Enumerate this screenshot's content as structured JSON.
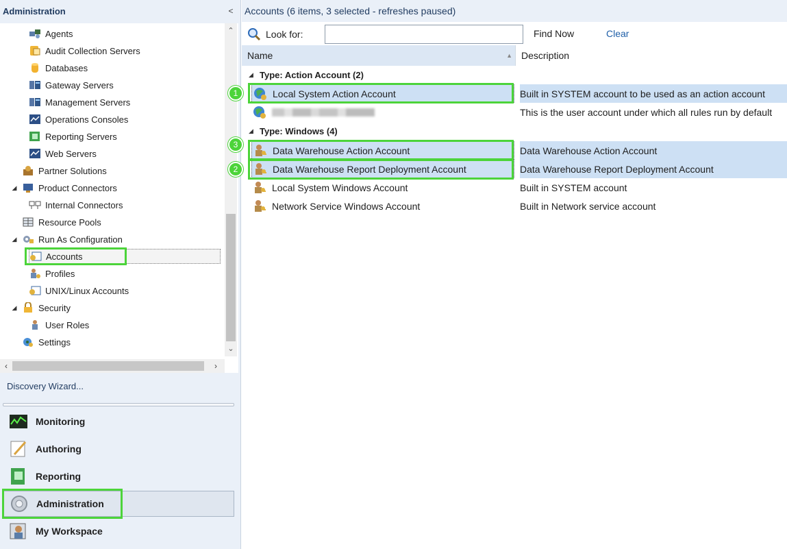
{
  "left_pane": {
    "title": "Administration",
    "collapse_glyph": "<",
    "tree": [
      {
        "label": "Agents",
        "icon": "agents-icon"
      },
      {
        "label": "Audit Collection Servers",
        "icon": "audit-servers-icon"
      },
      {
        "label": "Databases",
        "icon": "database-icon"
      },
      {
        "label": "Gateway Servers",
        "icon": "gateway-servers-icon"
      },
      {
        "label": "Management Servers",
        "icon": "management-servers-icon"
      },
      {
        "label": "Operations Consoles",
        "icon": "operations-consoles-icon"
      },
      {
        "label": "Reporting Servers",
        "icon": "reporting-servers-icon"
      },
      {
        "label": "Web Servers",
        "icon": "web-servers-icon"
      },
      {
        "label": "Partner Solutions",
        "icon": "partner-solutions-icon"
      },
      {
        "label": "Product Connectors",
        "icon": "product-connectors-icon",
        "expanded": true
      },
      {
        "label": "Internal Connectors",
        "icon": "internal-connectors-icon"
      },
      {
        "label": "Resource Pools",
        "icon": "resource-pools-icon"
      },
      {
        "label": "Run As Configuration",
        "icon": "run-as-config-icon",
        "expanded": true
      },
      {
        "label": "Accounts",
        "icon": "accounts-icon",
        "selected": true
      },
      {
        "label": "Profiles",
        "icon": "profiles-icon"
      },
      {
        "label": "UNIX/Linux Accounts",
        "icon": "unix-accounts-icon"
      },
      {
        "label": "Security",
        "icon": "security-lock-icon",
        "expanded": true
      },
      {
        "label": "User Roles",
        "icon": "user-roles-icon"
      },
      {
        "label": "Settings",
        "icon": "settings-icon"
      }
    ],
    "discovery_wizard": "Discovery Wizard...",
    "workspaces": [
      {
        "label": "Monitoring",
        "icon": "monitoring-icon"
      },
      {
        "label": "Authoring",
        "icon": "authoring-icon"
      },
      {
        "label": "Reporting",
        "icon": "reporting-icon"
      },
      {
        "label": "Administration",
        "icon": "administration-icon",
        "selected": true
      },
      {
        "label": "My Workspace",
        "icon": "my-workspace-icon"
      }
    ]
  },
  "right_pane": {
    "title": "Accounts",
    "title_detail": "(6 items, 3 selected - refreshes paused)",
    "search": {
      "label": "Look for:",
      "value": "",
      "find_now": "Find Now",
      "clear": "Clear"
    },
    "columns": {
      "name": "Name",
      "description": "Description"
    },
    "groups": [
      {
        "label": "Type: Action Account (2)",
        "rows": [
          {
            "name": "Local System Action Account",
            "description": "Built in SYSTEM account to be used as an action account",
            "icon": "action-account-globe-icon",
            "selected": true,
            "badge": "1"
          },
          {
            "name": "",
            "description": "This is the user account under which all rules run by default",
            "icon": "action-account-globe-icon",
            "selected": false,
            "redacted": true
          }
        ]
      },
      {
        "label": "Type: Windows (4)",
        "rows": [
          {
            "name": "Data Warehouse Action Account",
            "description": "Data Warehouse Action Account",
            "icon": "windows-account-key-icon",
            "selected": true,
            "badge": "3"
          },
          {
            "name": "Data Warehouse Report Deployment Account",
            "description": "Data Warehouse Report Deployment Account",
            "icon": "windows-account-key-icon",
            "selected": true,
            "badge": "2"
          },
          {
            "name": "Local System Windows Account",
            "description": "Built in SYSTEM account",
            "icon": "windows-account-key-icon",
            "selected": false
          },
          {
            "name": "Network Service Windows Account",
            "description": "Built in Network service account",
            "icon": "windows-account-key-icon",
            "selected": false
          }
        ]
      }
    ]
  },
  "colors": {
    "highlight_green": "#4cd43a",
    "selection_blue": "#cde0f4",
    "pane_bg": "#eaf0f8"
  }
}
